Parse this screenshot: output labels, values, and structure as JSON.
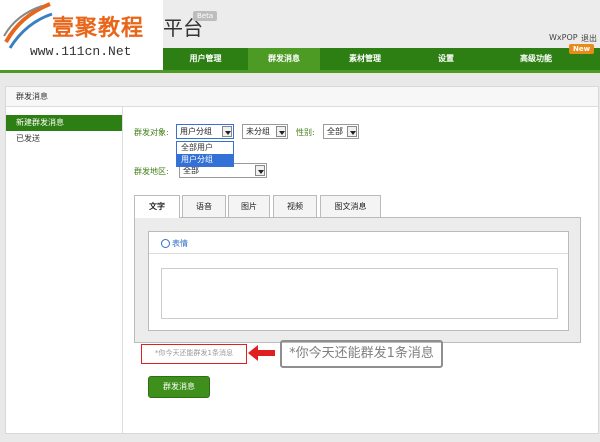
{
  "header": {
    "logo_cn": "壹聚教程",
    "logo_url": "www.111cn.Net",
    "title_tail": "平台",
    "beta": "Beta",
    "user_name": "WxPOP",
    "logout": "退出"
  },
  "nav": {
    "items": [
      "用户管理",
      "群发消息",
      "素材管理",
      "设置",
      "高级功能"
    ],
    "active_index": 1,
    "new_badge": "New"
  },
  "panel_title": "群发消息",
  "sidebar": {
    "items": [
      "新建群发消息",
      "已发送"
    ]
  },
  "form": {
    "target_label": "群发对象:",
    "target_value": "用户分组",
    "target_options": [
      "全部用户",
      "用户分组"
    ],
    "target_selected_option": "用户分组",
    "group_value": "未分组",
    "gender_label": "性别:",
    "gender_value": "全部",
    "region_label": "群发地区:",
    "region_value": "全部"
  },
  "tabs": [
    "文字",
    "语音",
    "图片",
    "视频",
    "图文消息"
  ],
  "active_tab": "文字",
  "editor": {
    "emoji_label": "表情"
  },
  "remain_small": "*你今天还能群发1条消息",
  "remain_big": "*你今天还能群发1条消息",
  "send_button": "群发消息",
  "colors": {
    "nav_green": "#2d7f13",
    "active_green": "#4d9b25",
    "highlight_red": "#e02020",
    "badge_orange": "#e88b1a"
  }
}
